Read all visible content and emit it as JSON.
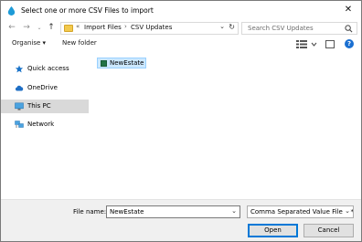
{
  "window": {
    "title": "Select one or more CSV Files to import",
    "close_glyph": "✕"
  },
  "address": {
    "overflow": "«",
    "crumbs": [
      "Import Files",
      "CSV Updates"
    ],
    "separator": "›",
    "dropdown_glyph": "⌄",
    "refresh_glyph": "↻"
  },
  "search": {
    "placeholder": "Search CSV Updates"
  },
  "toolbar": {
    "organise": "Organise ▾",
    "new_folder": "New folder"
  },
  "nav_pane": [
    {
      "label": "Quick access",
      "icon": "star-icon"
    },
    {
      "label": "OneDrive",
      "icon": "cloud-icon"
    },
    {
      "label": "This PC",
      "icon": "computer-icon",
      "selected": true
    },
    {
      "label": "Network",
      "icon": "network-icon"
    }
  ],
  "files": [
    {
      "name": "NewEstate",
      "icon": "csv-file-icon",
      "selected": true
    }
  ],
  "footer": {
    "file_name_label": "File name:",
    "file_name_value": "NewEstate",
    "file_type_value": "Comma Separated Value Files (*.csv)",
    "open_label": "Open",
    "cancel_label": "Cancel"
  },
  "colors": {
    "accent": "#0078d7",
    "selection": "#cce8ff",
    "footer_bg": "#f0f0f0"
  }
}
